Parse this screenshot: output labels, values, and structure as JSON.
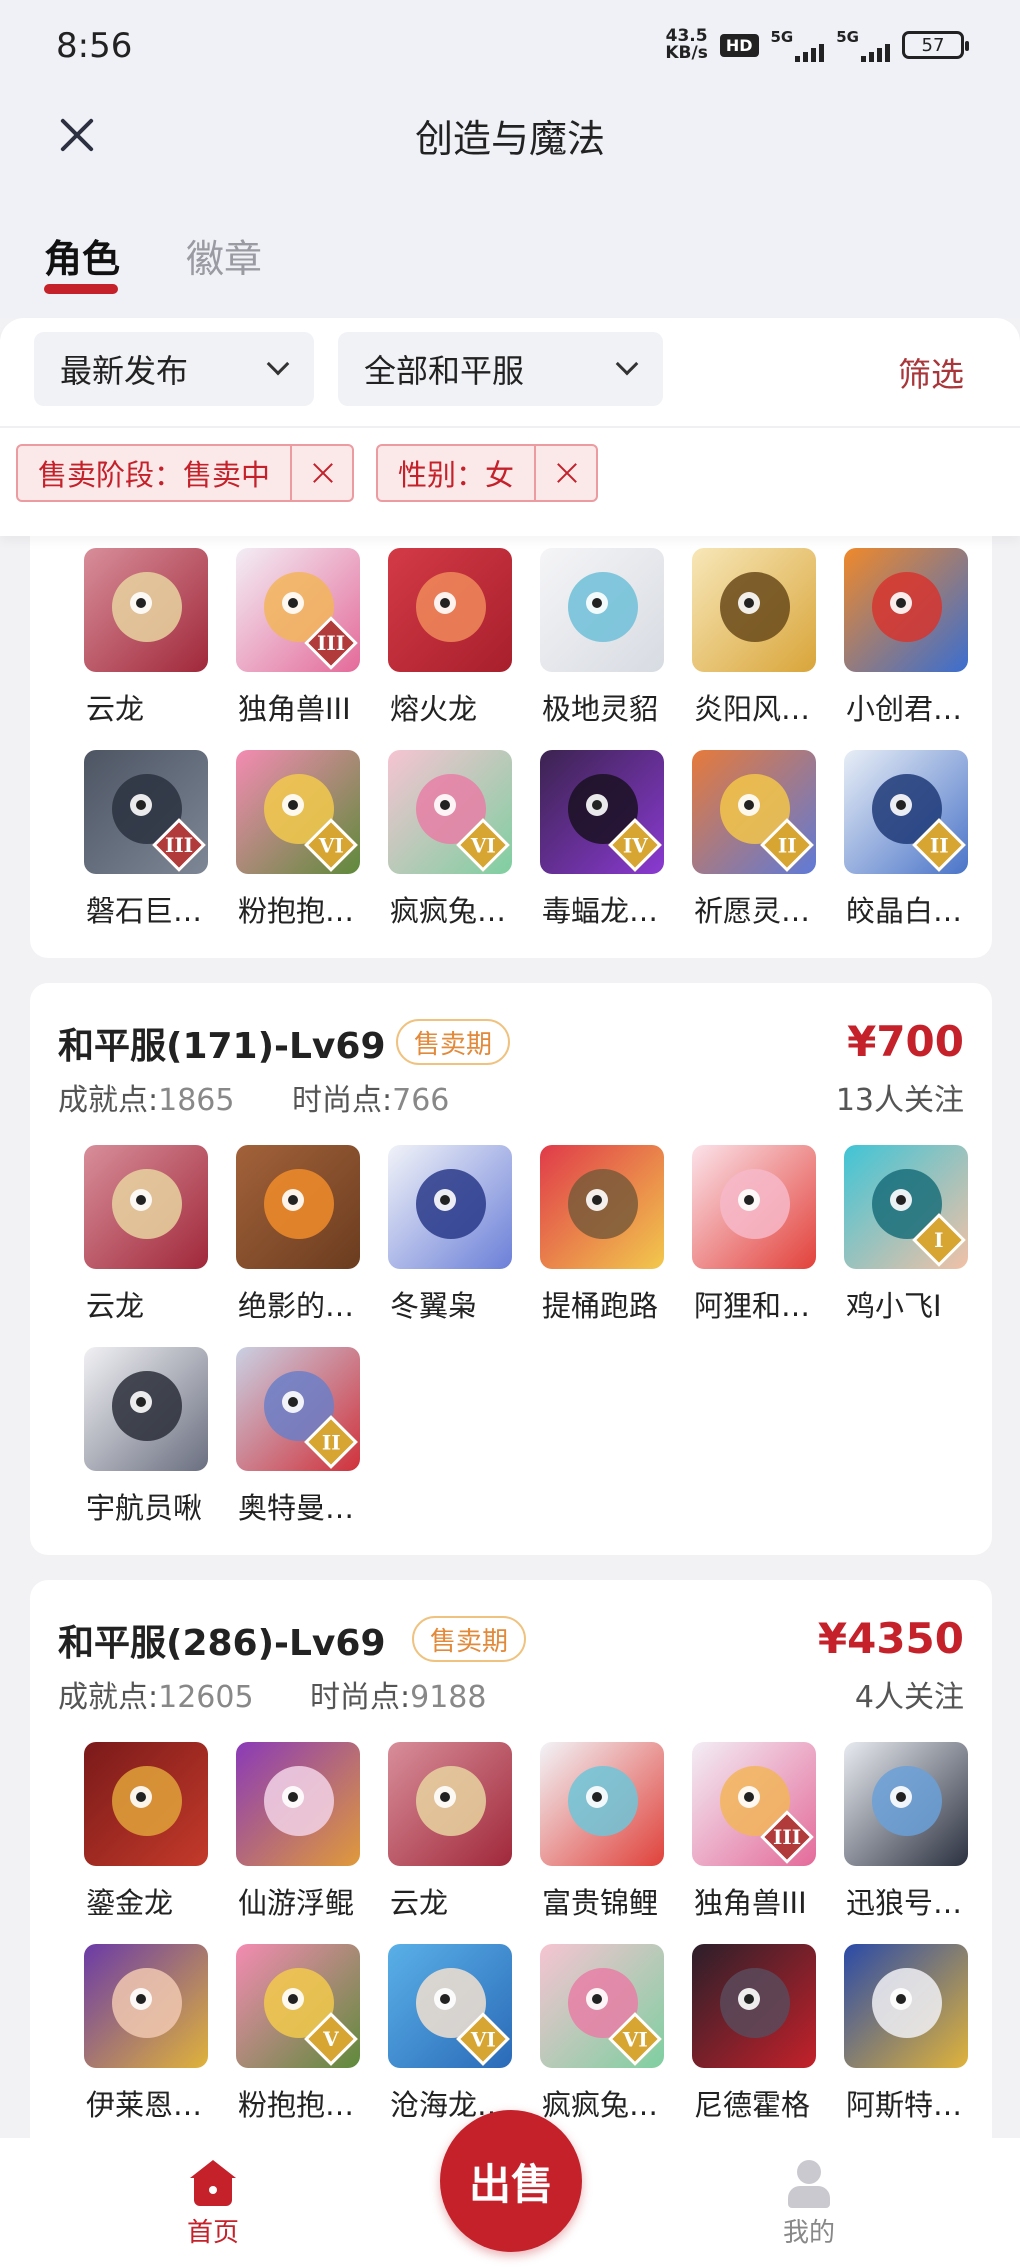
{
  "status_bar": {
    "time": "8:56",
    "net_speed_value": "43.5",
    "net_speed_unit": "KB/s",
    "hd": "HD",
    "sig1": "5G",
    "sig2": "5G",
    "battery": "57"
  },
  "header": {
    "title": "创造与魔法"
  },
  "tabs": [
    {
      "label": "角色",
      "active": true
    },
    {
      "label": "徽章",
      "active": false
    }
  ],
  "filters": {
    "sort": "最新发布",
    "server": "全部和平服",
    "filter_label": "筛选",
    "chips": [
      "售卖阶段：售卖中",
      "性别：女"
    ]
  },
  "icons": {
    "close": "close-icon",
    "chevron": "chevron-down-icon",
    "home": "home-icon",
    "user": "user-icon"
  },
  "colors": {
    "accent": "#c4212a",
    "badge": "#e2893a",
    "background": "#f2f2f5"
  },
  "listings": [
    {
      "items": [
        {
          "name": "云龙",
          "pal": [
            "#d88e9a",
            "#a0283a",
            "#e8d3a0"
          ]
        },
        {
          "name": "独角兽III",
          "pal": [
            "#f3eef6",
            "#e46a9a",
            "#f2b55a"
          ],
          "rank": "III"
        },
        {
          "name": "熔火龙",
          "pal": [
            "#d33a46",
            "#a81f2c",
            "#f08a5a"
          ]
        },
        {
          "name": "极地灵貂",
          "pal": [
            "#f5f5f7",
            "#d7dbe2",
            "#6fc0d8"
          ]
        },
        {
          "name": "炎阳风…",
          "pal": [
            "#f7e7b8",
            "#d9a53a",
            "#6a4a1a"
          ]
        },
        {
          "name": "小创君…",
          "pal": [
            "#f0892a",
            "#3a6ed0",
            "#d6352f"
          ]
        },
        {
          "name": "磐石巨…",
          "pal": [
            "#4d5563",
            "#7d8796",
            "#2a3140"
          ],
          "rank": "III"
        },
        {
          "name": "粉抱抱…",
          "pal": [
            "#f48bb3",
            "#5e8a3a",
            "#f2c94c"
          ],
          "rank": "VI"
        },
        {
          "name": "疯疯兔…",
          "pal": [
            "#f6c4d2",
            "#7ecfa0",
            "#e77fa6"
          ],
          "rank": "VI"
        },
        {
          "name": "毒蝠龙…",
          "pal": [
            "#3b234f",
            "#8a3ad2",
            "#1a1022"
          ],
          "rank": "IV"
        },
        {
          "name": "祈愿灵…",
          "pal": [
            "#e77a3a",
            "#5e7ad8",
            "#f2c64a"
          ],
          "rank": "II"
        },
        {
          "name": "皎晶白…",
          "pal": [
            "#e8eef6",
            "#4a74c8",
            "#1f3a78"
          ],
          "rank": "II"
        }
      ]
    },
    {
      "name": "和平服(171)-Lv69",
      "stage": "售卖期",
      "price": "¥700",
      "achievement_label": "成就点:",
      "achievement": "1865",
      "fashion_label": "时尚点:",
      "fashion": "766",
      "followers": "13人关注",
      "items": [
        {
          "name": "云龙",
          "pal": [
            "#d88e9a",
            "#a0283a",
            "#e8d3a0"
          ]
        },
        {
          "name": "绝影的…",
          "pal": [
            "#a2623a",
            "#6b3c1f",
            "#f08c2a"
          ]
        },
        {
          "name": "冬翼枭",
          "pal": [
            "#f1f3f8",
            "#6b7fd8",
            "#2a3a8a"
          ]
        },
        {
          "name": "提桶跑路",
          "pal": [
            "#e03a4a",
            "#f2c94c",
            "#7a5a3a"
          ]
        },
        {
          "name": "阿狸和…",
          "pal": [
            "#fbe3ea",
            "#e2413a",
            "#f7b8c9"
          ]
        },
        {
          "name": "鸡小飞I",
          "pal": [
            "#3fc4d6",
            "#f2c1a6",
            "#1a6e7a"
          ],
          "rank": "I"
        },
        {
          "name": "宇航员啾",
          "pal": [
            "#f1f1f4",
            "#6a6f80",
            "#2c2f3a"
          ]
        },
        {
          "name": "奥特曼…",
          "pal": [
            "#c9d1e4",
            "#d0313a",
            "#6b7fc8"
          ],
          "rank": "II"
        }
      ]
    },
    {
      "name": "和平服(286)-Lv69",
      "stage": "售卖期",
      "price": "¥4350",
      "achievement_label": "成就点:",
      "achievement": "12605",
      "fashion_label": "时尚点:",
      "fashion": "9188",
      "followers": "4人关注",
      "items": [
        {
          "name": "鎏金龙",
          "pal": [
            "#7a1a1a",
            "#c43a2a",
            "#e0a23a"
          ]
        },
        {
          "name": "仙游浮鲲",
          "pal": [
            "#8a3ab8",
            "#e09a3a",
            "#f2d2e6"
          ]
        },
        {
          "name": "云龙",
          "pal": [
            "#d88e9a",
            "#a0283a",
            "#e8d3a0"
          ]
        },
        {
          "name": "富贵锦鲤",
          "pal": [
            "#f2f4f8",
            "#e0413a",
            "#6ec6d8"
          ]
        },
        {
          "name": "独角兽III",
          "pal": [
            "#f3eef6",
            "#e46a9a",
            "#f2b55a"
          ],
          "rank": "III"
        },
        {
          "name": "迅狼号…",
          "pal": [
            "#e8ebf0",
            "#2c3140",
            "#6aa0d8"
          ]
        },
        {
          "name": "伊莱恩…",
          "pal": [
            "#6a3aa8",
            "#e0b33a",
            "#f0c8b0"
          ]
        },
        {
          "name": "粉抱抱…",
          "pal": [
            "#f48bb3",
            "#5e8a3a",
            "#f2c94c"
          ],
          "rank": "V"
        },
        {
          "name": "沧海龙…",
          "pal": [
            "#5ab0e8",
            "#2a6ab8",
            "#f2e0d0"
          ],
          "rank": "VI"
        },
        {
          "name": "疯疯兔…",
          "pal": [
            "#f6c4d2",
            "#7ecfa0",
            "#e77fa6"
          ],
          "rank": "VI"
        },
        {
          "name": "尼德霍格",
          "pal": [
            "#2a1f2a",
            "#c4212a",
            "#5a4a5a"
          ]
        },
        {
          "name": "阿斯特…",
          "pal": [
            "#2a4aa8",
            "#e0b33a",
            "#f0f0f4"
          ]
        }
      ]
    }
  ],
  "bottom_nav": {
    "home": "首页",
    "sell": "出售",
    "mine": "我的"
  }
}
